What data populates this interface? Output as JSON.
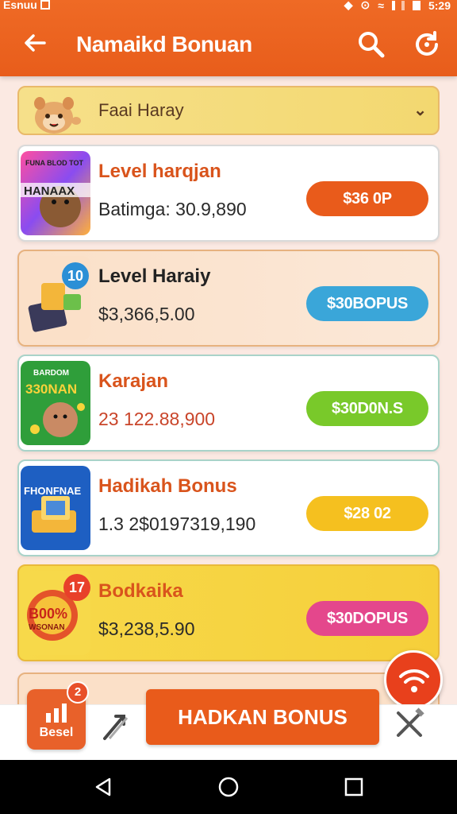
{
  "status_bar": {
    "carrier": "Esnuu",
    "time": "5:29"
  },
  "header": {
    "title": "Namaikd Bonuan"
  },
  "filter": {
    "label": "Faai Haray"
  },
  "cards": [
    {
      "name": "Level harqjan",
      "amount": "Batimga: 30.9,890",
      "button": "$36 0P",
      "name_color": "#d9541c",
      "button_color": "#e95b1b",
      "thumb_text": "HANAAX",
      "thumb_top": "FUNA BLOD TOT"
    },
    {
      "name": "Level Haraiy",
      "amount": "$3,366,5.00",
      "button": "$30BOPUS",
      "name_color": "#222222",
      "button_color": "#3aa6d9",
      "badge": "10",
      "badge_color": "#2b8fd6"
    },
    {
      "name": "Karajan",
      "amount": "23 122.88,900",
      "button": "$30D0N.S",
      "name_color": "#d9541c",
      "button_color": "#79c92a",
      "thumb_text": "330NAN",
      "thumb_top": "BARDOM"
    },
    {
      "name": "Hadikah Bonus",
      "amount": "1.3 2$0197319,190",
      "button": "$28 02",
      "name_color": "#d9541c",
      "button_color": "#f5c01f",
      "thumb_text": "FHONFNAE"
    },
    {
      "name": "Bodkaika",
      "amount": "$3,238,5.90",
      "button": "$30DOPUS",
      "name_color": "#d9541c",
      "button_color": "#e4478c",
      "badge": "17",
      "badge_color": "#e8402a",
      "thumb_text": "B00%",
      "thumb_top": "WSONAN"
    }
  ],
  "bottom_bar": {
    "tab_label": "Besel",
    "tab_badge": "2",
    "cta_label": "HADKAN BONUS"
  }
}
